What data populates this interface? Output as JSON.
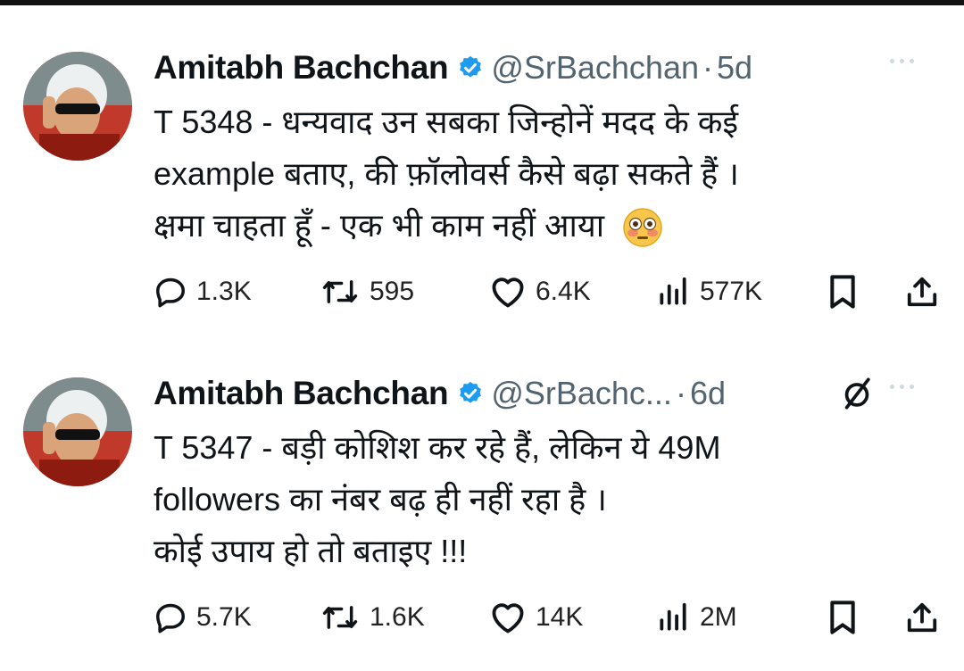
{
  "tweets": [
    {
      "author_name": "Amitabh Bachchan",
      "handle": "@SrBachchan",
      "separator": "·",
      "time": "5d",
      "lines": [
        "T 5348 - धन्यवाद उन सबका जिन्होनें मदद के कई",
        "example बताए, की फ़ॉलोवर्स कैसे बढ़ा सकते हैं  ।",
        "क्षमा चाहता हूँ  - एक भी काम नहीं आया"
      ],
      "emoji": "flushed-face-emoji",
      "replies": "1.3K",
      "reposts": "595",
      "likes": "6.4K",
      "views": "577K"
    },
    {
      "author_name": "Amitabh Bachchan",
      "handle": "@SrBachc...",
      "separator": "·",
      "time": "6d",
      "lines": [
        "T 5347 - बड़ी कोशिश कर रहे हैं, लेकिन ये 49M",
        "followers का नंबर बढ़ ही नहीं रहा है  ।",
        "कोई उपाय हो तो बताइए  !!!"
      ],
      "replies": "5.7K",
      "reposts": "1.6K",
      "likes": "14K",
      "views": "2M"
    }
  ],
  "colors": {
    "verified": "#1d9bf0",
    "secondary_text": "#536471",
    "primary_text": "#0f1419"
  }
}
